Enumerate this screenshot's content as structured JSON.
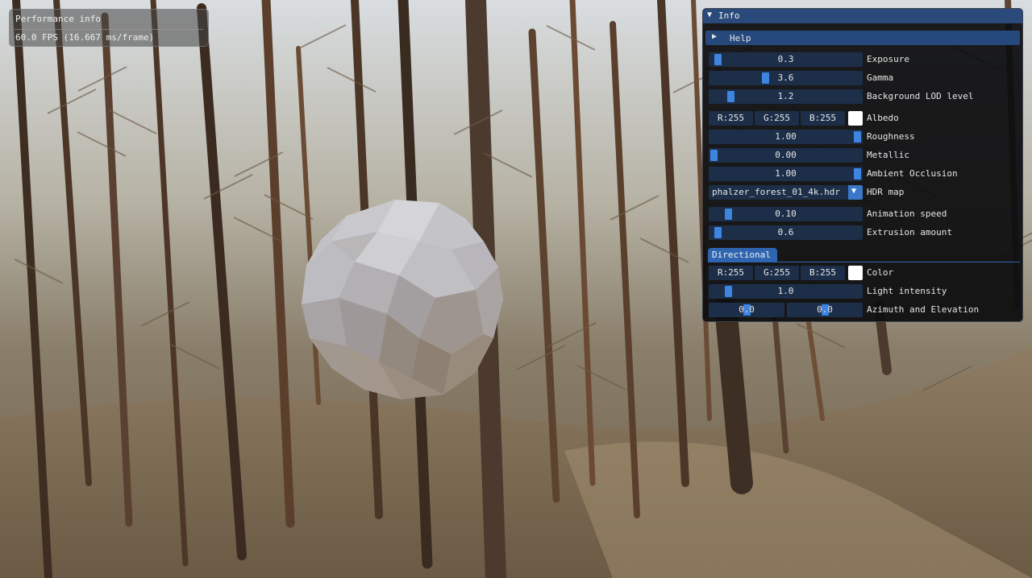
{
  "performance": {
    "title": "Performance info",
    "fps_text": "60.0 FPS (16.667 ms/frame)"
  },
  "info": {
    "title": "Info",
    "help_label": "Help",
    "exposure": {
      "label": "Exposure",
      "value": "0.3",
      "fraction": 0.03
    },
    "gamma": {
      "label": "Gamma",
      "value": "3.6",
      "fraction": 0.36
    },
    "background_lod": {
      "label": "Background LOD level",
      "value": "1.2",
      "fraction": 0.12
    },
    "albedo": {
      "label": "Albedo",
      "r": "R:255",
      "g": "G:255",
      "b": "B:255",
      "color": "#ffffff"
    },
    "roughness": {
      "label": "Roughness",
      "value": "1.00",
      "fraction": 1.0
    },
    "metallic": {
      "label": "Metallic",
      "value": "0.00",
      "fraction": 0.0
    },
    "ambient_occlusion": {
      "label": "Ambient Occlusion",
      "value": "1.00",
      "fraction": 1.0
    },
    "hdr_map": {
      "label": "HDR map",
      "value": "phalzer_forest_01_4k.hdr"
    },
    "animation_speed": {
      "label": "Animation speed",
      "value": "0.10",
      "fraction": 0.1
    },
    "extrusion_amount": {
      "label": "Extrusion amount",
      "value": "0.6",
      "fraction": 0.03
    },
    "directional_tab": "Directional",
    "color": {
      "label": "Color",
      "r": "R:255",
      "g": "G:255",
      "b": "B:255",
      "color": "#ffffff"
    },
    "light_intensity": {
      "label": "Light intensity",
      "value": "1.0",
      "fraction": 0.1
    },
    "azimuth_elevation": {
      "label": "Azimuth and Elevation",
      "azimuth": "0.0",
      "elevation": "0.0",
      "az_fraction": 0.5,
      "el_fraction": 0.5
    }
  },
  "colors": {
    "accent": "#3d85e0",
    "title_bg": "#294a7a",
    "frame_bg": "#1d2e48"
  }
}
